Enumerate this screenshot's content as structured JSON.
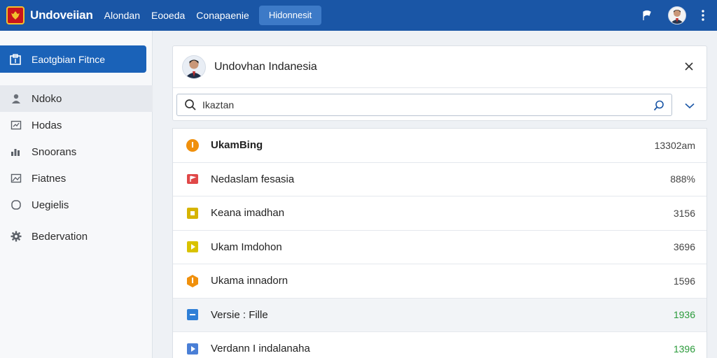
{
  "header": {
    "brand": "Undoveiian",
    "nav": [
      "Alondan",
      "Eooeda",
      "Conapaenie"
    ],
    "active_tab": "Hidonnesit"
  },
  "sidebar": {
    "primary": {
      "label": "Eaotgbian Fitnce",
      "icon": "clipboard-icon"
    },
    "items": [
      {
        "label": "Ndoko",
        "icon": "user-icon",
        "active": true
      },
      {
        "label": "Hodas",
        "icon": "chart-card-icon",
        "active": false
      },
      {
        "label": "Snoorans",
        "icon": "bar-chart-icon",
        "active": false
      },
      {
        "label": "Fiatnes",
        "icon": "image-icon",
        "active": false
      },
      {
        "label": "Uegielis",
        "icon": "circle-icon",
        "active": false
      },
      {
        "label": "Bedervation",
        "icon": "gear-icon",
        "active": false
      }
    ]
  },
  "panel": {
    "title": "Undovhan Indanesia",
    "search": {
      "value": "Ikaztan"
    }
  },
  "list": [
    {
      "name": "UkamBing",
      "value": "13302am",
      "icon": "info-circle-icon",
      "color": "#f0900c",
      "bold": true,
      "green": false
    },
    {
      "name": "Nedaslam fesasia",
      "value": "888%",
      "icon": "flag-icon",
      "color": "#e04848",
      "bold": false,
      "green": false
    },
    {
      "name": "Keana imadhan",
      "value": "3156",
      "icon": "square-icon",
      "color": "#d6b400",
      "bold": false,
      "green": false
    },
    {
      "name": "Ukam Imdohon",
      "value": "3696",
      "icon": "play-icon",
      "color": "#d9c200",
      "bold": false,
      "green": false
    },
    {
      "name": "Ukama innadorn",
      "value": "1596",
      "icon": "hexagon-icon",
      "color": "#f0900c",
      "bold": false,
      "green": false
    },
    {
      "name": "Versie : Fille",
      "value": "1936",
      "icon": "minus-square-icon",
      "color": "#2f7fd6",
      "bold": false,
      "green": true
    },
    {
      "name": "Verdann I indalanaha",
      "value": "1396",
      "icon": "play-square-icon",
      "color": "#4a7fd6",
      "bold": false,
      "green": true
    }
  ],
  "colors": {
    "topbar": "#1a56a6",
    "accent": "#1a62b8",
    "green": "#2a9a3a"
  }
}
